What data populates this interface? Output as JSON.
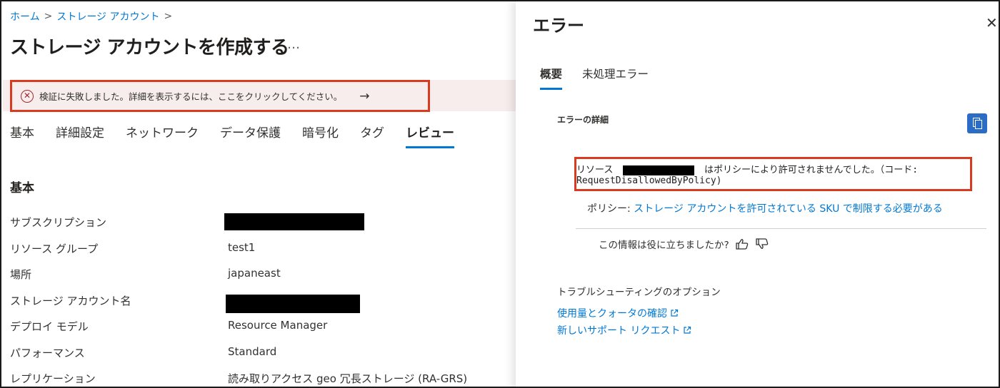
{
  "breadcrumb": {
    "home": "ホーム",
    "separator": ">",
    "storage": "ストレージ アカウント"
  },
  "page": {
    "title": "ストレージ アカウントを作成する",
    "more": "…"
  },
  "banner": {
    "message": "検証に失敗しました。詳細を表示するには、ここをクリックしてください。",
    "arrow": "→",
    "icon": "x-circle-icon",
    "border_color": "#d83b1f",
    "icon_glyph": "✕"
  },
  "tabs": [
    {
      "label": "基本",
      "active": false
    },
    {
      "label": "詳細設定",
      "active": false
    },
    {
      "label": "ネットワーク",
      "active": false
    },
    {
      "label": "データ保護",
      "active": false
    },
    {
      "label": "暗号化",
      "active": false
    },
    {
      "label": "タグ",
      "active": false
    },
    {
      "label": "レビュー",
      "active": true
    }
  ],
  "review": {
    "section_title": "基本",
    "rows": [
      {
        "label": "サブスクリプション",
        "value": "",
        "redacted": true
      },
      {
        "label": "リソース グループ",
        "value": "test1",
        "redacted": false
      },
      {
        "label": "場所",
        "value": "japaneast",
        "redacted": false
      },
      {
        "label": "ストレージ アカウント名",
        "value": "",
        "redacted": true
      },
      {
        "label": "デプロイ モデル",
        "value": "Resource Manager",
        "redacted": false
      },
      {
        "label": "パフォーマンス",
        "value": "Standard",
        "redacted": false
      },
      {
        "label": "レプリケーション",
        "value": "読み取りアクセス geo 冗長ストレージ (RA-GRS)",
        "redacted": false
      }
    ]
  },
  "error_panel": {
    "title": "エラー",
    "close": "✕",
    "tabs": [
      {
        "label": "概要",
        "active": true
      },
      {
        "label": "未処理エラー",
        "active": false
      }
    ],
    "details_heading": "エラーの詳細",
    "copy_icon": "copy-icon",
    "error_prefix": "リソース",
    "error_suffix": "はポリシーにより許可されませんでした。（コード:",
    "error_code": "RequestDisallowedByPolicy)",
    "policy_label": "ポリシー:",
    "policy_link": "ストレージ アカウントを許可されている SKU で制限する必要がある",
    "feedback_question": "この情報は役に立ちましたか?",
    "troubleshooting_heading": "トラブルシューティングのオプション",
    "links": [
      {
        "label": "使用量とクォータの確認"
      },
      {
        "label": "新しいサポート リクエスト"
      }
    ],
    "accent_color": "#0078d4"
  }
}
